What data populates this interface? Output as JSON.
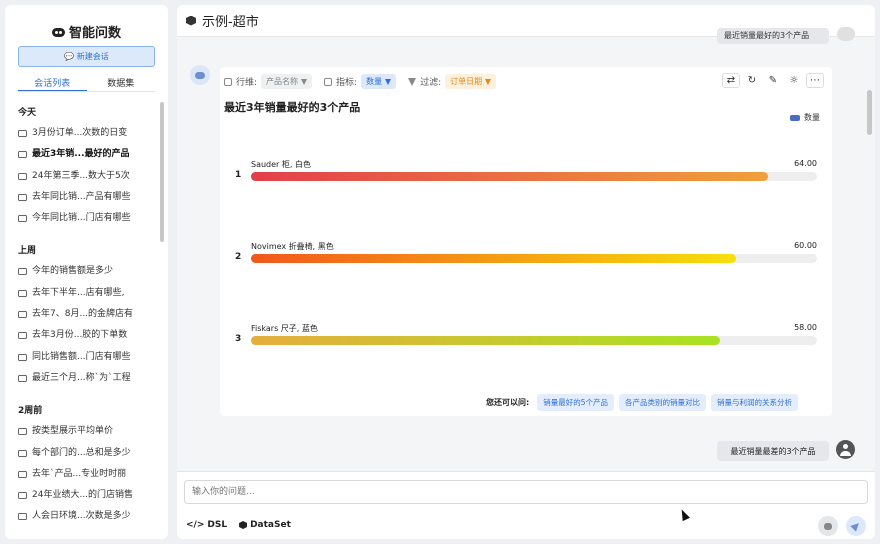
{
  "sidebar": {
    "title": "智能问数",
    "new_chat_label": "💬 新建会话",
    "tabs": [
      "会话列表",
      "数据集"
    ],
    "groups": [
      {
        "label": "今天",
        "items": [
          "3月份订单...次数的日变",
          "最近3年销...最好的产品",
          "24年第三季...数大于5次",
          "去年同比销...产品有哪些",
          "今年同比销...门店有哪些"
        ]
      },
      {
        "label": "上周",
        "items": [
          "今年的销售额是多少",
          "去年下半年...店有哪些,",
          "去年7、8月...的金牌店有",
          "去年3月份...胶的下单数",
          "同比销售额...门店有哪些",
          "最近三个月...称`为`工程"
        ]
      },
      {
        "label": "2周前",
        "items": [
          "按类型展示平均单价",
          "每个部门的...总和是多少",
          "去年`产品...专业时时丽",
          "24年业绩大...的门店销售",
          "人会日环境...次数是多少"
        ]
      }
    ]
  },
  "header": {
    "title": "示例-超市"
  },
  "messages": {
    "top_user_text": "最近销量最好的3个产品",
    "last_user_text": "最近销量最差的3个产品"
  },
  "card": {
    "dimension_label": "行维:",
    "dimension_value": "产品名称",
    "metric_label": "指标:",
    "metric_value": "数量",
    "filter_label": "过滤:",
    "filter_value": "订单日期",
    "action_icons": [
      "shuffle-icon",
      "refresh-icon",
      "edit-icon",
      "bulb-icon",
      "more-icon"
    ],
    "suggest_label": "您还可以问:",
    "suggestions": [
      "销量最好的5个产品",
      "各产品类别的销量对比",
      "销量与利润的关系分析"
    ]
  },
  "chart_data": {
    "type": "bar",
    "orientation": "horizontal",
    "title": "最近3年销量最好的3个产品",
    "series": [
      {
        "name": "数量",
        "values": [
          64.0,
          60.0,
          58.0
        ]
      }
    ],
    "categories": [
      "Sauder 柜, 白色",
      "Novimex 折叠椅, 黑色",
      "Fiskars 尺子, 蓝色"
    ],
    "ranks": [
      "1",
      "2",
      "3"
    ],
    "value_labels": [
      "64.00",
      "60.00",
      "58.00"
    ],
    "xlim": [
      0,
      70
    ],
    "legend": "top-right",
    "colors": [
      [
        "#e33f4a",
        "#f0a03a"
      ],
      [
        "#f2571c",
        "#f7df0b"
      ],
      [
        "#e6ad3d",
        "#a9e322"
      ]
    ],
    "legend_color": "#4a6cc9"
  },
  "composer": {
    "placeholder": "输入你的问题...",
    "dsl_label": "DSL",
    "dataset_label": "DataSet"
  }
}
